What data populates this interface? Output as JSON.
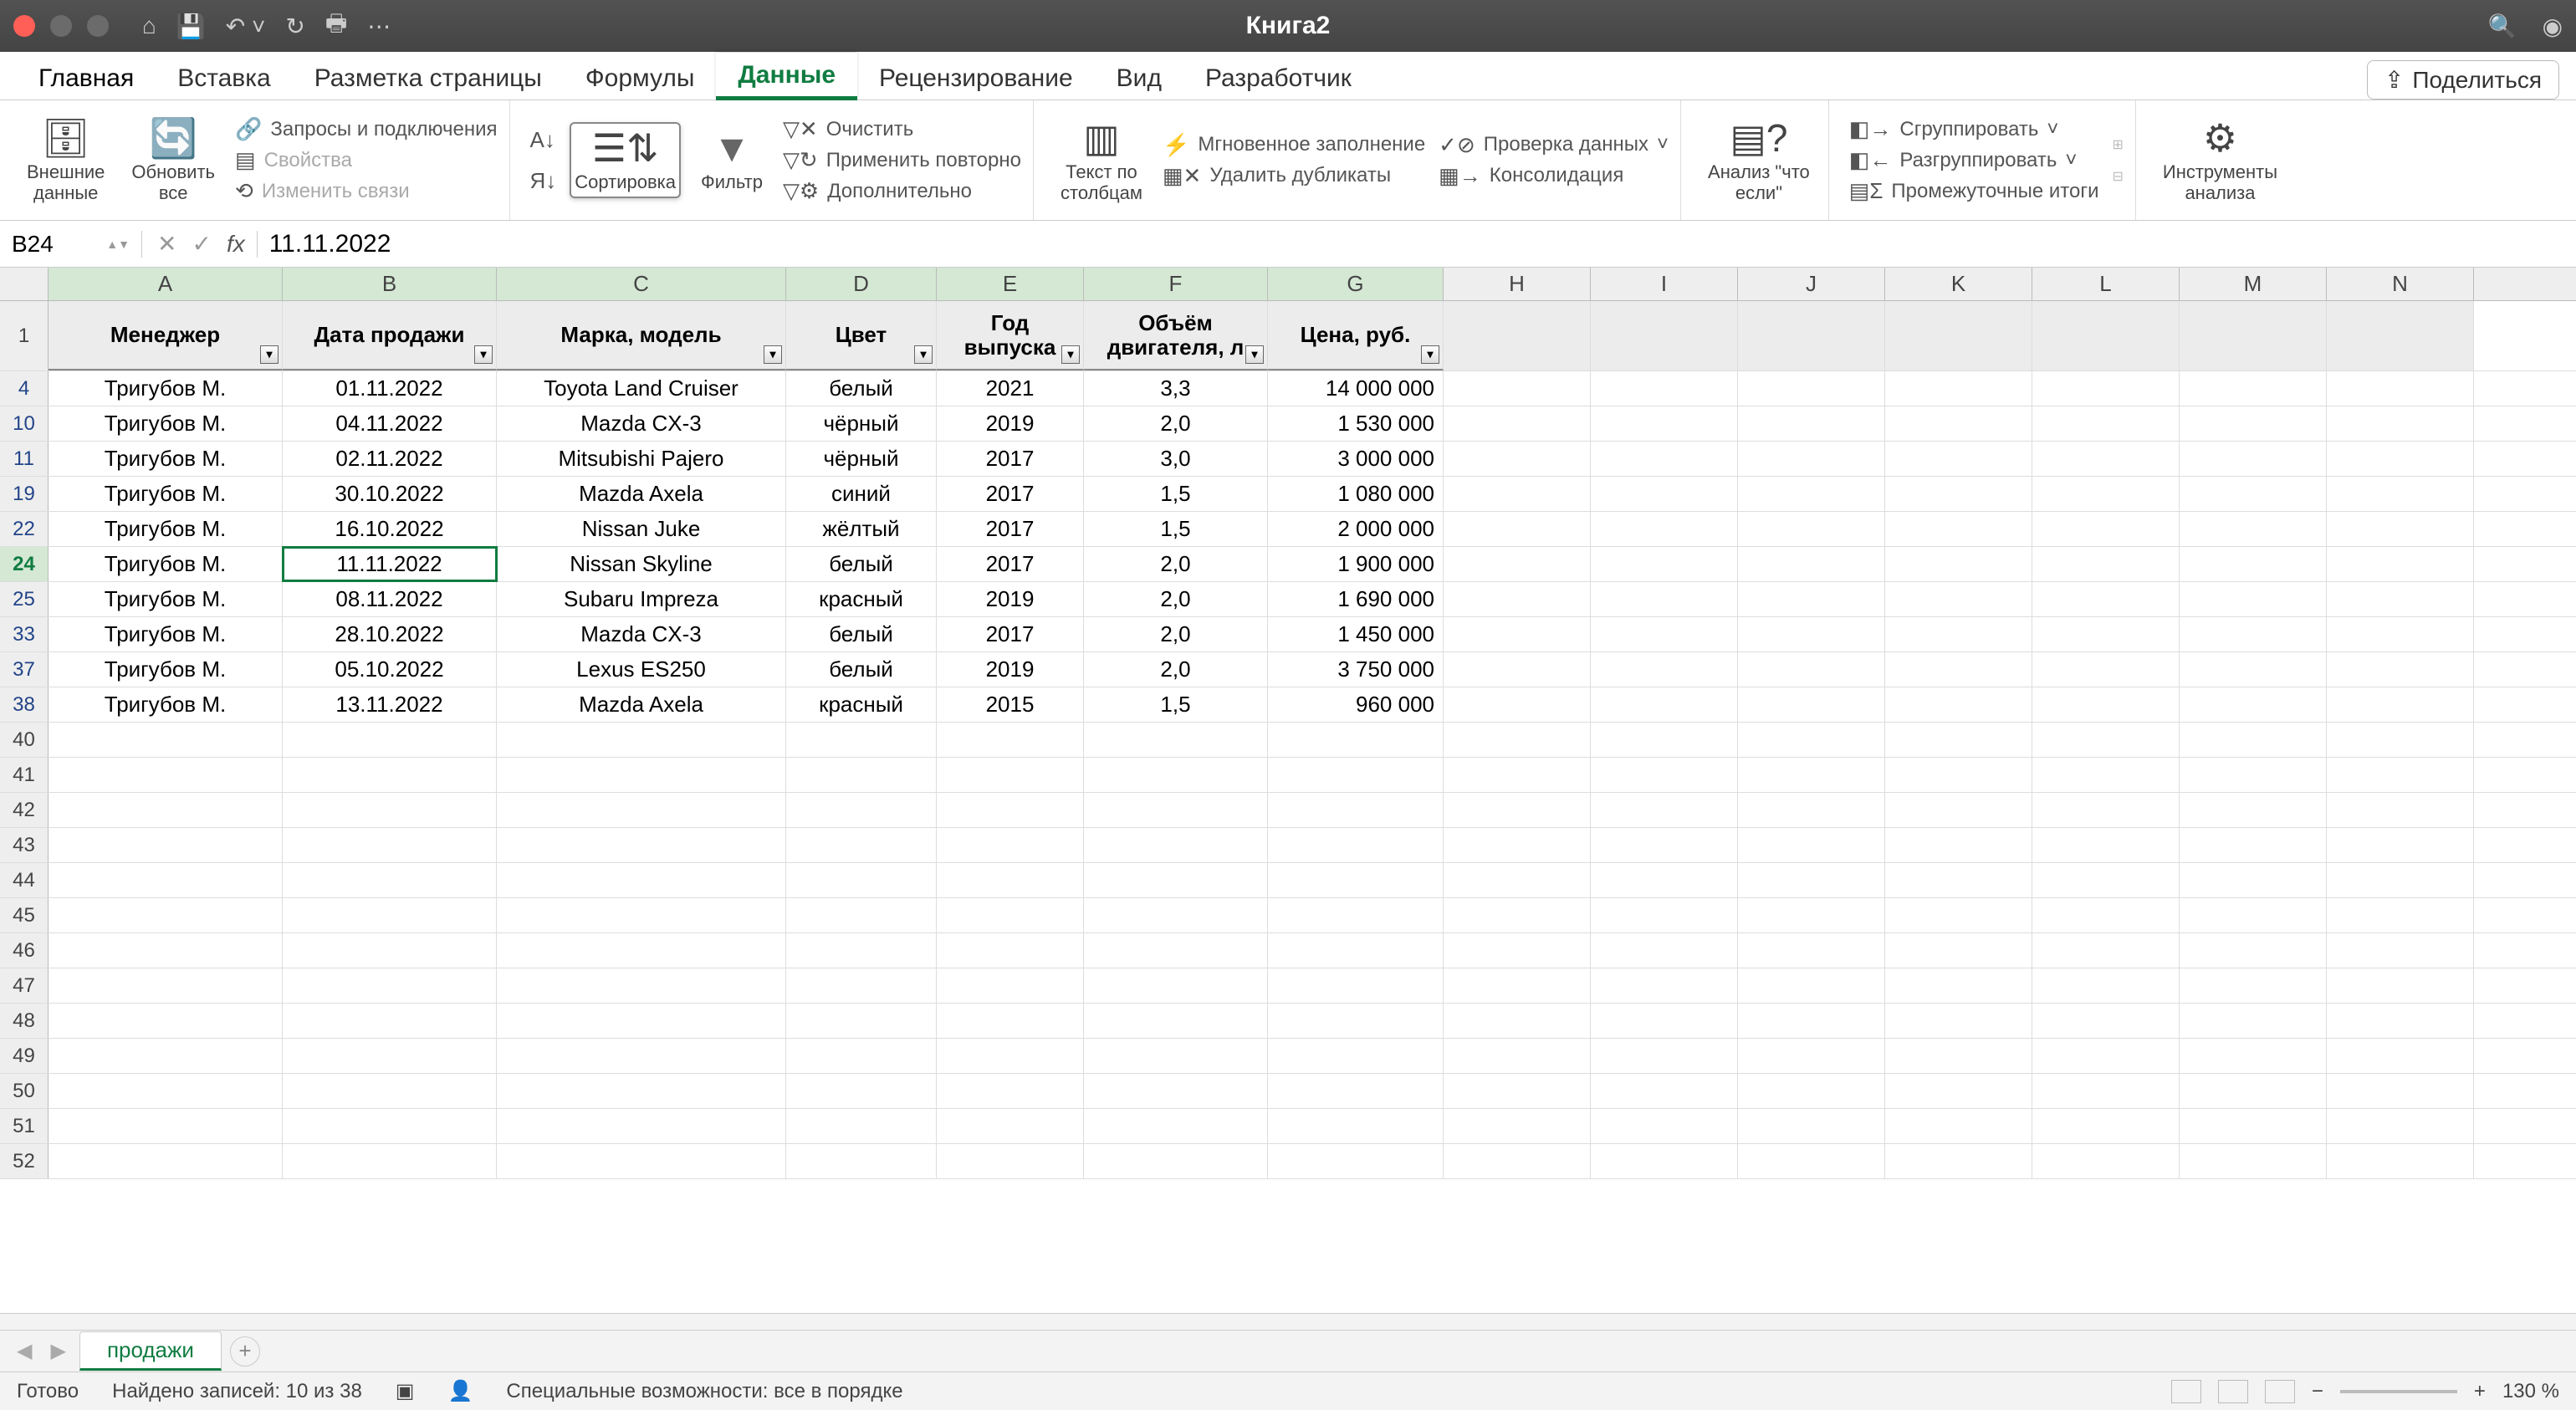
{
  "app_title": "Книга2",
  "menu_tabs": [
    "Главная",
    "Вставка",
    "Разметка страницы",
    "Формулы",
    "Данные",
    "Рецензирование",
    "Вид",
    "Разработчик"
  ],
  "active_tab_index": 4,
  "share_label": "Поделиться",
  "ribbon": {
    "external_data": "Внешние\nданные",
    "refresh_all": "Обновить\nвсе",
    "queries": "Запросы и подключения",
    "properties": "Свойства",
    "edit_links": "Изменить связи",
    "sort": "Сортировка",
    "filter": "Фильтр",
    "clear": "Очистить",
    "reapply": "Применить повторно",
    "advanced": "Дополнительно",
    "text_to_columns": "Текст по\nстолбцам",
    "flash_fill": "Мгновенное заполнение",
    "remove_dup": "Удалить дубликаты",
    "data_validation": "Проверка данных",
    "consolidate": "Консолидация",
    "what_if": "Анализ \"что\nесли\"",
    "group": "Сгруппировать",
    "ungroup": "Разгруппировать",
    "subtotals": "Промежуточные итоги",
    "analysis_tools": "Инструменты\nанализа"
  },
  "cell_ref": "B24",
  "formula_value": "11.11.2022",
  "col_headers": [
    "A",
    "B",
    "C",
    "D",
    "E",
    "F",
    "G",
    "H",
    "I",
    "J",
    "K",
    "L",
    "M",
    "N"
  ],
  "table_headers": [
    "Менеджер",
    "Дата продажи",
    "Марка, модель",
    "Цвет",
    "Год выпуска",
    "Объём двигателя, л",
    "Цена, руб."
  ],
  "row_numbers_data": [
    "4",
    "10",
    "11",
    "19",
    "22",
    "24",
    "25",
    "33",
    "37",
    "38"
  ],
  "row_numbers_empty": [
    "40",
    "41",
    "42",
    "43",
    "44",
    "45",
    "46",
    "47",
    "48",
    "49",
    "50",
    "51",
    "52"
  ],
  "selected_row_index": 5,
  "rows": [
    {
      "mgr": "Тригубов М.",
      "date": "01.11.2022",
      "model": "Toyota Land Cruiser",
      "color": "белый",
      "year": "2021",
      "engine": "3,3",
      "price": "14 000 000"
    },
    {
      "mgr": "Тригубов М.",
      "date": "04.11.2022",
      "model": "Mazda CX-3",
      "color": "чёрный",
      "year": "2019",
      "engine": "2,0",
      "price": "1 530 000"
    },
    {
      "mgr": "Тригубов М.",
      "date": "02.11.2022",
      "model": "Mitsubishi Pajero",
      "color": "чёрный",
      "year": "2017",
      "engine": "3,0",
      "price": "3 000 000"
    },
    {
      "mgr": "Тригубов М.",
      "date": "30.10.2022",
      "model": "Mazda Axela",
      "color": "синий",
      "year": "2017",
      "engine": "1,5",
      "price": "1 080 000"
    },
    {
      "mgr": "Тригубов М.",
      "date": "16.10.2022",
      "model": "Nissan Juke",
      "color": "жёлтый",
      "year": "2017",
      "engine": "1,5",
      "price": "2 000 000"
    },
    {
      "mgr": "Тригубов М.",
      "date": "11.11.2022",
      "model": "Nissan Skyline",
      "color": "белый",
      "year": "2017",
      "engine": "2,0",
      "price": "1 900 000"
    },
    {
      "mgr": "Тригубов М.",
      "date": "08.11.2022",
      "model": "Subaru Impreza",
      "color": "красный",
      "year": "2019",
      "engine": "2,0",
      "price": "1 690 000"
    },
    {
      "mgr": "Тригубов М.",
      "date": "28.10.2022",
      "model": "Mazda CX-3",
      "color": "белый",
      "year": "2017",
      "engine": "2,0",
      "price": "1 450 000"
    },
    {
      "mgr": "Тригубов М.",
      "date": "05.10.2022",
      "model": "Lexus ES250",
      "color": "белый",
      "year": "2019",
      "engine": "2,0",
      "price": "3 750 000"
    },
    {
      "mgr": "Тригубов М.",
      "date": "13.11.2022",
      "model": "Mazda Axela",
      "color": "красный",
      "year": "2015",
      "engine": "1,5",
      "price": "960 000"
    }
  ],
  "sheet_name": "продажи",
  "status_ready": "Готово",
  "status_found": "Найдено записей: 10 из 38",
  "status_accessibility": "Специальные возможности: все в порядке",
  "zoom": "130 %"
}
